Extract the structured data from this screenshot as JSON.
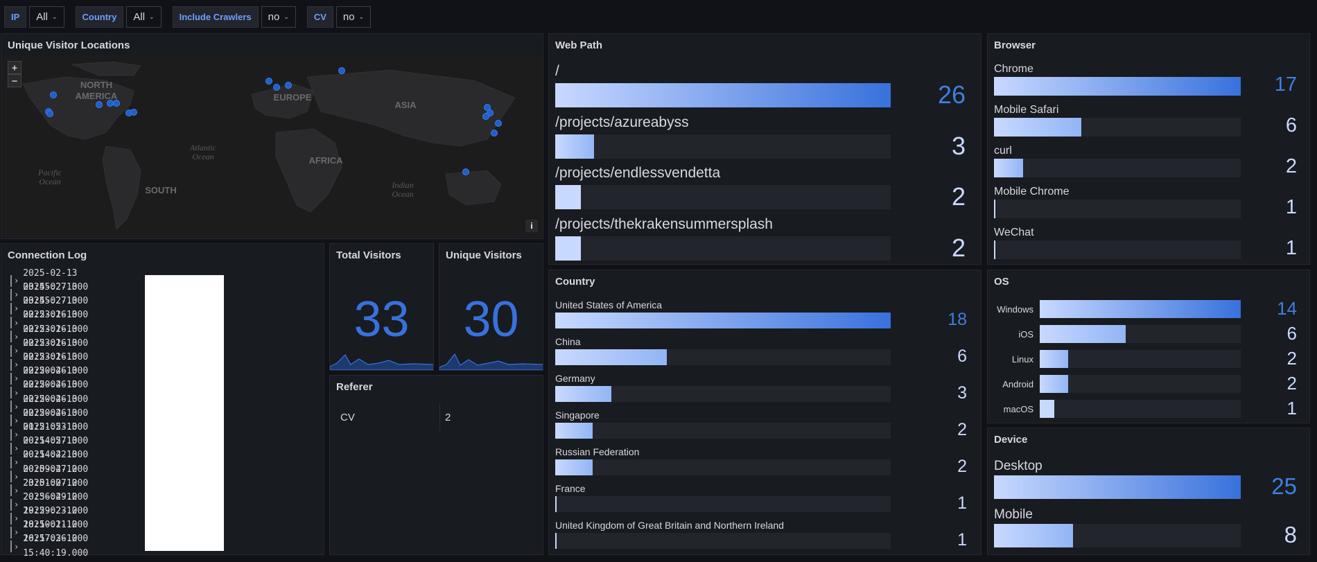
{
  "variables": [
    {
      "label": "IP",
      "value": "All"
    },
    {
      "label": "Country",
      "value": "All"
    },
    {
      "label": "Include Crawlers",
      "value": "no"
    },
    {
      "label": "CV",
      "value": "no"
    }
  ],
  "map": {
    "title": "Unique Visitor Locations",
    "zoom_in": "+",
    "zoom_out": "−",
    "info": "i",
    "labels": [
      "NORTH AMERICA",
      "EUROPE",
      "ASIA",
      "AFRICA",
      "SOUTH",
      "Atlantic Ocean",
      "Pacific Ocean",
      "Indian Ocean"
    ]
  },
  "connection_log": {
    "title": "Connection Log",
    "rows": [
      "2025-02-13 03:45:27.000",
      "2025-02-13 03:45:27.000",
      "2025-02-13 02:23:16.000",
      "2025-02-13 02:23:16.000",
      "2025-02-13 02:23:16.000",
      "2025-02-13 02:23:16.000",
      "2025-02-13 02:20:46.000",
      "2025-02-13 02:20:46.000",
      "2025-02-13 02:20:46.000",
      "2025-02-13 02:20:46.000",
      "2025-02-13 01:21:53.000",
      "2025-02-13 00:14:57.000",
      "2025-02-13 00:14:42.000",
      "2025-02-13 00:09:47.000",
      "2025-02-12 23:01:07.000",
      "2025-02-12 20:36:49.000",
      "2025-02-12 19:29:23.000",
      "2025-02-12 18:10:11.000",
      "2025-02-12 16:17:36.000",
      "2025-02-12 15:40:19.000"
    ]
  },
  "total_visitors": {
    "title": "Total Visitors",
    "value": "33"
  },
  "unique_visitors": {
    "title": "Unique Visitors",
    "value": "30"
  },
  "referer": {
    "title": "Referer",
    "rows": [
      {
        "name": "CV",
        "count": "2"
      }
    ]
  },
  "web_path": {
    "title": "Web Path",
    "max": 26,
    "items": [
      {
        "label": "/",
        "value": 26
      },
      {
        "label": "/projects/azureabyss",
        "value": 3
      },
      {
        "label": "/projects/endlessvendetta",
        "value": 2
      },
      {
        "label": "/projects/thekrakensummersplash",
        "value": 2
      }
    ]
  },
  "country": {
    "title": "Country",
    "max": 18,
    "items": [
      {
        "label": "United States of America",
        "value": 18
      },
      {
        "label": "China",
        "value": 6
      },
      {
        "label": "Germany",
        "value": 3
      },
      {
        "label": "Singapore",
        "value": 2
      },
      {
        "label": "Russian Federation",
        "value": 2
      },
      {
        "label": "France",
        "value": 1
      },
      {
        "label": "United Kingdom of Great Britain and Northern Ireland",
        "value": 1
      }
    ]
  },
  "browser": {
    "title": "Browser",
    "max": 17,
    "items": [
      {
        "label": "Chrome",
        "value": 17
      },
      {
        "label": "Mobile Safari",
        "value": 6
      },
      {
        "label": "curl",
        "value": 2
      },
      {
        "label": "Mobile Chrome",
        "value": 1
      },
      {
        "label": "WeChat",
        "value": 1
      }
    ]
  },
  "os": {
    "title": "OS",
    "max": 14,
    "items": [
      {
        "label": "Windows",
        "value": 14
      },
      {
        "label": "iOS",
        "value": 6
      },
      {
        "label": "Linux",
        "value": 2
      },
      {
        "label": "Android",
        "value": 2
      },
      {
        "label": "macOS",
        "value": 1
      }
    ]
  },
  "device": {
    "title": "Device",
    "max": 25,
    "items": [
      {
        "label": "Desktop",
        "value": 25
      },
      {
        "label": "Mobile",
        "value": 8
      }
    ]
  }
}
